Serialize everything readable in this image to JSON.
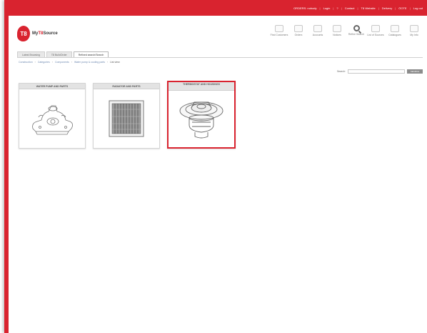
{
  "topbar": {
    "links": [
      "ORDERS: nobody",
      "Login",
      "?",
      "Contact",
      "T8 Website",
      "Delivery",
      "ÖOTE",
      "Log out"
    ]
  },
  "brand": {
    "logo_mark": "T8",
    "name_part1": "My",
    "name_part2": "T8",
    "name_part3": "Source"
  },
  "toolbar": {
    "items": [
      {
        "label": "Find Customers",
        "icon": "customers-icon"
      },
      {
        "label": "Orders",
        "icon": "orders-icon"
      },
      {
        "label": "Accounts",
        "icon": "accounts-icon"
      },
      {
        "label": "Notices",
        "icon": "notices-icon"
      },
      {
        "label": "Refine Search",
        "icon": "search-icon"
      },
      {
        "label": "List of Sources",
        "icon": "list-icon"
      },
      {
        "label": "Catalogues",
        "icon": "catalogue-icon"
      },
      {
        "label": "My Info",
        "icon": "info-icon"
      }
    ]
  },
  "tabs": [
    {
      "label": "Latest Browsing",
      "active": false
    },
    {
      "label": "T8 BuildOrder",
      "active": false
    },
    {
      "label": "Refined search/Search",
      "active": true
    }
  ],
  "breadcrumb": {
    "items": [
      "Construction",
      "Categories",
      "Components",
      "Water pump & cooling parts"
    ],
    "current": "List view"
  },
  "search": {
    "label": "Search:",
    "value": "",
    "button": "SEARCH"
  },
  "cards": [
    {
      "title": "WATER PUMP AND PARTS",
      "image": "water-pump-icon",
      "selected": false
    },
    {
      "title": "RADIATOR AND PARTS",
      "image": "radiator-icon",
      "selected": false
    },
    {
      "title": "THERMOSTAT AND HOUSINGS",
      "image": "thermostat-icon",
      "selected": true
    }
  ],
  "colors": {
    "accent": "#d9232f",
    "link": "#6d88b0"
  }
}
